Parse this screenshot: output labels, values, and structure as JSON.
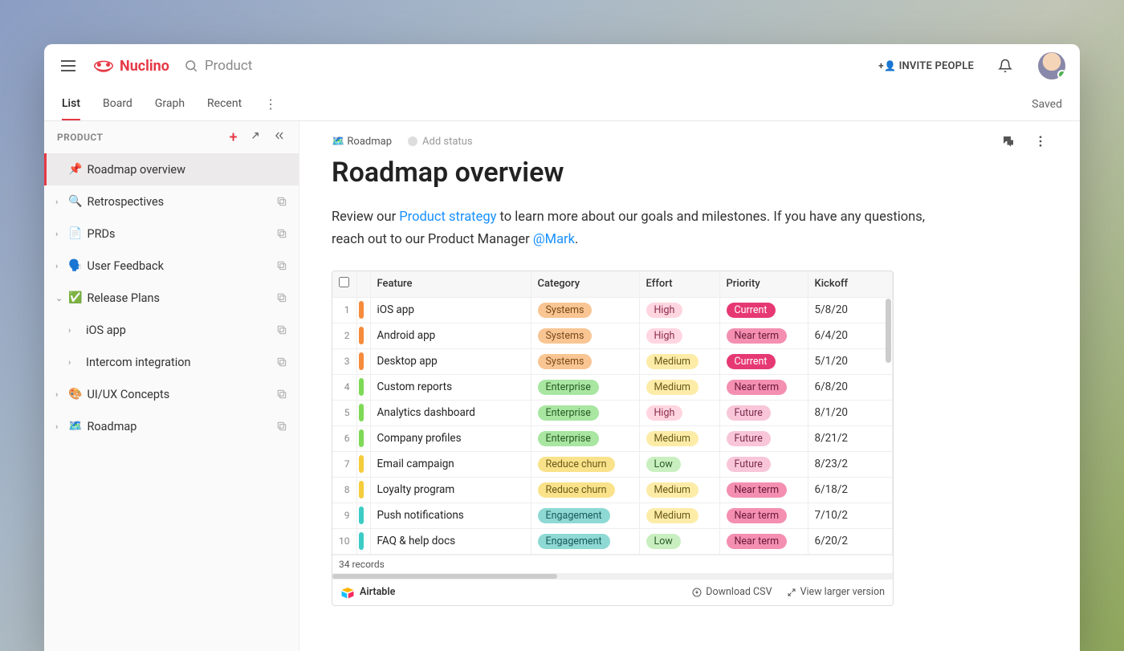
{
  "brand": "Nuclino",
  "search_placeholder": "Product",
  "invite_label": "INVITE PEOPLE",
  "tabs": {
    "items": [
      "List",
      "Board",
      "Graph",
      "Recent"
    ],
    "active": 0
  },
  "saved_label": "Saved",
  "sidebar": {
    "title": "PRODUCT",
    "items": [
      {
        "emoji": "📌",
        "label": "Roadmap overview",
        "depth": 0,
        "chev": "",
        "active": true,
        "copy": false
      },
      {
        "emoji": "🔍",
        "label": "Retrospectives",
        "depth": 0,
        "chev": "›",
        "copy": true
      },
      {
        "emoji": "📄",
        "label": "PRDs",
        "depth": 0,
        "chev": "›",
        "copy": true
      },
      {
        "emoji": "🗣️",
        "label": "User Feedback",
        "depth": 0,
        "chev": "›",
        "copy": true
      },
      {
        "emoji": "✅",
        "label": "Release Plans",
        "depth": 0,
        "chev": "⌄",
        "copy": true
      },
      {
        "emoji": "",
        "label": "iOS app",
        "depth": 1,
        "chev": "›",
        "copy": true
      },
      {
        "emoji": "",
        "label": "Intercom integration",
        "depth": 1,
        "chev": "›",
        "copy": true
      },
      {
        "emoji": "🎨",
        "label": "UI/UX Concepts",
        "depth": 0,
        "chev": "›",
        "copy": true
      },
      {
        "emoji": "🗺️",
        "label": "Roadmap",
        "depth": 0,
        "chev": "›",
        "copy": true
      }
    ]
  },
  "doc": {
    "breadcrumb_emoji": "🗺️",
    "breadcrumb": "Roadmap",
    "add_status": "Add status",
    "title": "Roadmap overview",
    "text_before": "Review our ",
    "link1": "Product strategy",
    "text_mid": " to learn more about our goals and milestones. If you have any questions, reach out to our Product Manager ",
    "mention": "@Mark",
    "text_after": "."
  },
  "table": {
    "headers": [
      "Feature",
      "Category",
      "Effort",
      "Priority",
      "Kickoff"
    ],
    "rows": [
      {
        "n": 1,
        "bar": "orange",
        "feature": "iOS app",
        "category": "Systems",
        "effort": "High",
        "priority": "Current",
        "kickoff": "5/8/20"
      },
      {
        "n": 2,
        "bar": "orange",
        "feature": "Android app",
        "category": "Systems",
        "effort": "High",
        "priority": "Near term",
        "kickoff": "6/4/20"
      },
      {
        "n": 3,
        "bar": "orange",
        "feature": "Desktop app",
        "category": "Systems",
        "effort": "Medium",
        "priority": "Current",
        "kickoff": "5/1/20"
      },
      {
        "n": 4,
        "bar": "green",
        "feature": "Custom reports",
        "category": "Enterprise",
        "effort": "Medium",
        "priority": "Near term",
        "kickoff": "6/8/20"
      },
      {
        "n": 5,
        "bar": "green",
        "feature": "Analytics dashboard",
        "category": "Enterprise",
        "effort": "High",
        "priority": "Future",
        "kickoff": "8/1/20"
      },
      {
        "n": 6,
        "bar": "green",
        "feature": "Company profiles",
        "category": "Enterprise",
        "effort": "Medium",
        "priority": "Future",
        "kickoff": "8/21/2"
      },
      {
        "n": 7,
        "bar": "yellow",
        "feature": "Email campaign",
        "category": "Reduce churn",
        "effort": "Low",
        "priority": "Future",
        "kickoff": "8/23/2"
      },
      {
        "n": 8,
        "bar": "yellow",
        "feature": "Loyalty program",
        "category": "Reduce churn",
        "effort": "Medium",
        "priority": "Near term",
        "kickoff": "6/18/2"
      },
      {
        "n": 9,
        "bar": "teal",
        "feature": "Push notifications",
        "category": "Engagement",
        "effort": "Medium",
        "priority": "Near term",
        "kickoff": "7/10/2"
      },
      {
        "n": 10,
        "bar": "teal",
        "feature": "FAQ & help docs",
        "category": "Engagement",
        "effort": "Low",
        "priority": "Near term",
        "kickoff": "6/20/2"
      }
    ],
    "records_label": "34 records",
    "airtable_label": "Airtable",
    "download_label": "Download CSV",
    "larger_label": "View larger version"
  }
}
